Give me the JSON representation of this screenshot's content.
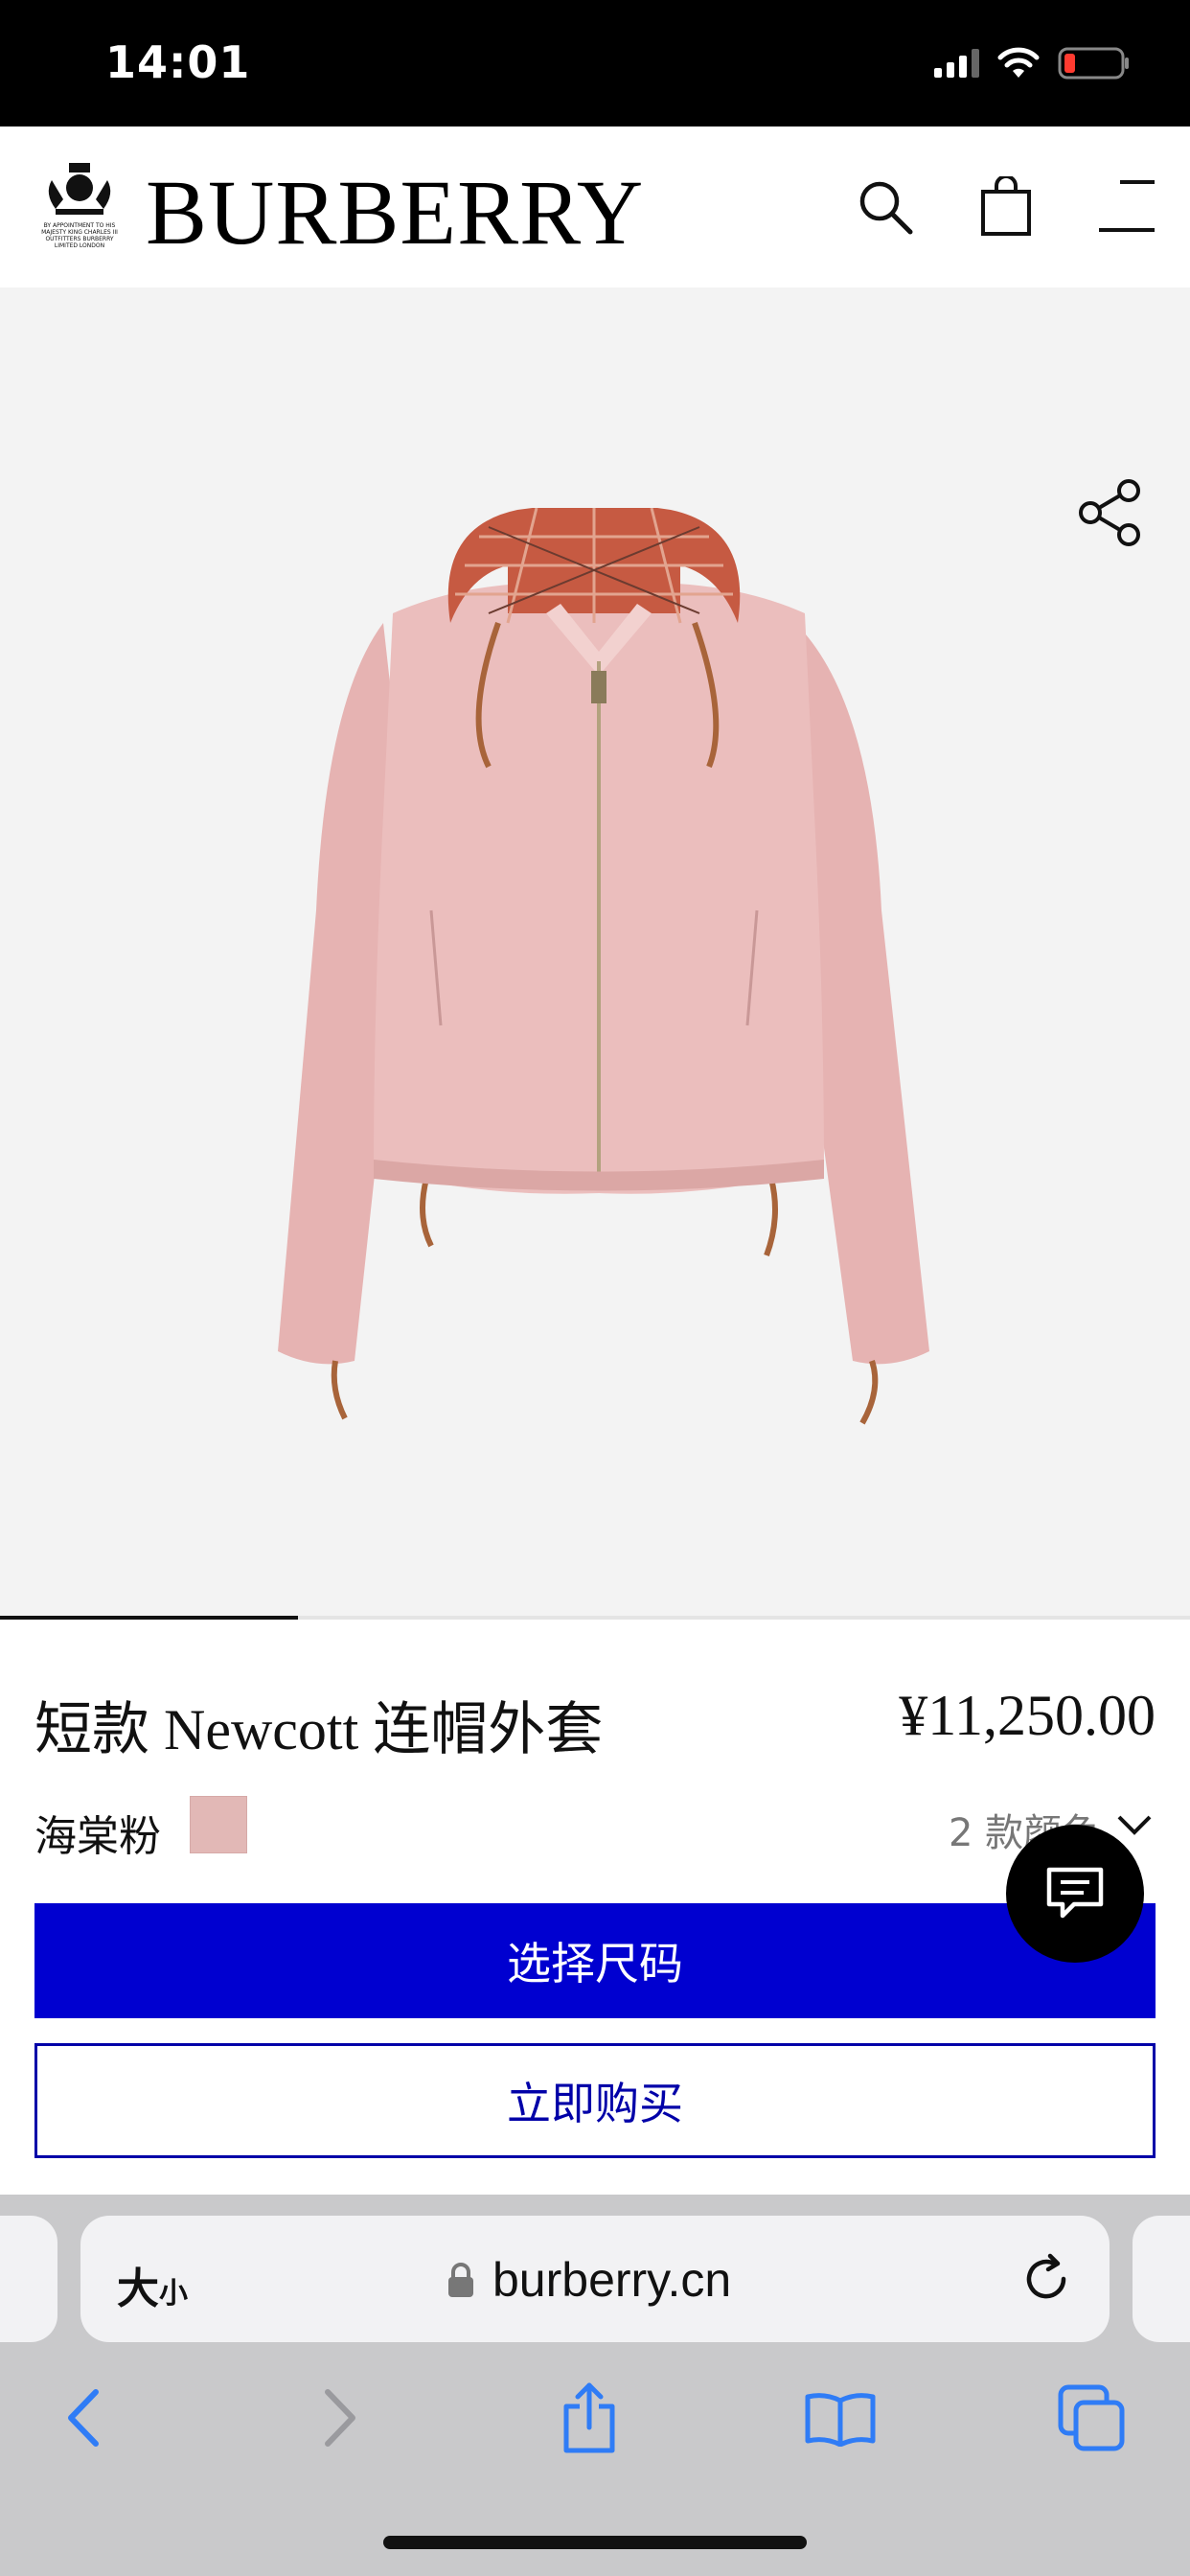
{
  "status_bar": {
    "time": "14:01",
    "icons": [
      "cellular-signal-icon",
      "wifi-icon",
      "battery-low-icon"
    ]
  },
  "header": {
    "crest_text": "BY APPOINTMENT TO HIS MAJESTY KING CHARLES III OUTFITTERS BURBERRY LIMITED LONDON",
    "brand": "BURBERRY",
    "icons": [
      "search-icon",
      "shopping-bag-icon",
      "menu-icon"
    ]
  },
  "gallery": {
    "share_icon": "share-icon",
    "progress": 0.25
  },
  "product": {
    "name": "短款 Newcott 连帽外套",
    "price": "¥11,250.00",
    "color_name": "海棠粉",
    "swatch_color": "#e2b8b6",
    "colors_count": "2 款颜色",
    "primary_button": "选择尺码",
    "secondary_button": "立即购买",
    "chat_icon": "chat-icon"
  },
  "browser": {
    "text_size_big": "大",
    "text_size_small": "小",
    "url": "burberry.cn",
    "nav_icons": [
      "back-icon",
      "forward-icon",
      "share-icon",
      "bookmarks-icon",
      "tabs-icon"
    ]
  },
  "colors": {
    "accent_blue": "#0000d0",
    "browser_blue": "#2f7cf6"
  }
}
